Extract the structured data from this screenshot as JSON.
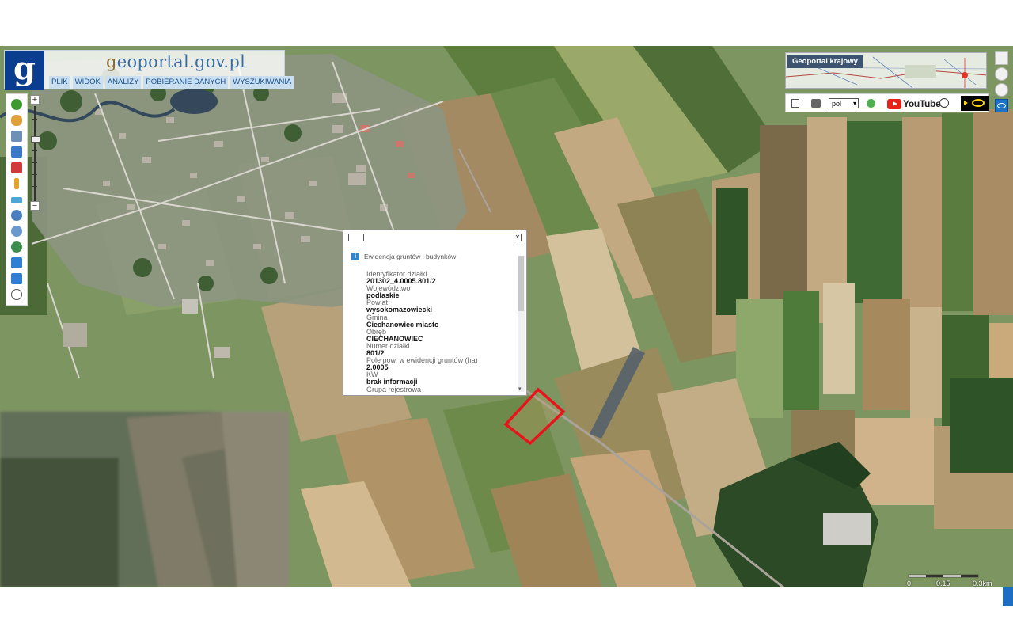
{
  "header": {
    "logo_letter": "g",
    "brand_prefix": "g",
    "brand_rest": "eoportal.gov.pl",
    "tabs": [
      "PLIK",
      "WIDOK",
      "ANALIZY",
      "POBIERANIE DANYCH",
      "WYSZUKIWANIA"
    ]
  },
  "zoom": {
    "plus": "+",
    "minus": "−"
  },
  "minimap": {
    "label": "Geoportal krajowy"
  },
  "toolsbar": {
    "language": "pol",
    "youtube": "YouTube"
  },
  "popup": {
    "title": "Ewidencja gruntów i budynków",
    "fields": [
      {
        "label": "Identyfikator działki",
        "value": "201302_4.0005.801/2"
      },
      {
        "label": "Województwo",
        "value": "podlaskie"
      },
      {
        "label": "Powiat",
        "value": "wysokomazowiecki"
      },
      {
        "label": "Gmina",
        "value": "Ciechanowiec miasto"
      },
      {
        "label": "Obręb",
        "value": "CIECHANOWIEC"
      },
      {
        "label": "Numer działki",
        "value": "801/2"
      },
      {
        "label": "Pole pow. w ewidencji gruntów (ha)",
        "value": "2.0005"
      },
      {
        "label": "KW",
        "value": "brak informacji"
      },
      {
        "label": "Grupa rejestrowa",
        "value": ""
      }
    ]
  },
  "scale": {
    "start": "0",
    "mid": "0.15",
    "end": "0.3km"
  },
  "colors": {
    "parcel_outline": "#e8141c",
    "header_tab_bg": "#c9dff0",
    "logo_bg": "#0b3d8e",
    "accent_blue": "#1b6ec2"
  }
}
